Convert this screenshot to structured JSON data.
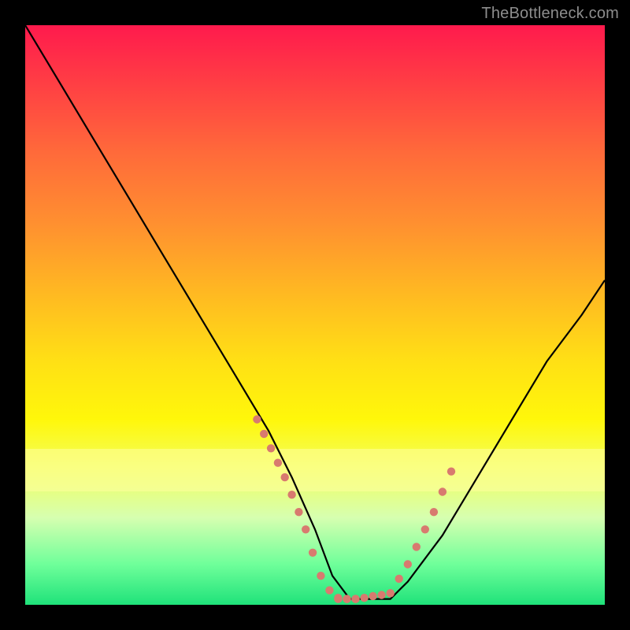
{
  "watermark": "TheBottleneck.com",
  "chart_data": {
    "type": "line",
    "title": "",
    "xlabel": "",
    "ylabel": "",
    "xlim": [
      0,
      100
    ],
    "ylim": [
      0,
      100
    ],
    "series": [
      {
        "name": "bottleneck-curve",
        "x": [
          0,
          6,
          12,
          18,
          24,
          30,
          36,
          42,
          46,
          50,
          53,
          56,
          60,
          63,
          66,
          72,
          78,
          84,
          90,
          96,
          100
        ],
        "values": [
          100,
          90,
          80,
          70,
          60,
          50,
          40,
          30,
          22,
          13,
          5,
          1,
          1,
          1,
          4,
          12,
          22,
          32,
          42,
          50,
          56
        ]
      }
    ],
    "markers": {
      "name": "dotted-highlight",
      "color": "#d87a6f",
      "left_segment": {
        "x": [
          40,
          41.2,
          42.4,
          43.6,
          44.8,
          46,
          47.2,
          48.4,
          49.6,
          51,
          52.5,
          54,
          55.5,
          57
        ],
        "y": [
          32,
          29.5,
          27,
          24.5,
          22,
          19,
          16,
          13,
          9,
          5,
          2.5,
          1.2,
          1,
          1
        ]
      },
      "right_segment": {
        "x": [
          63,
          64.5,
          66,
          67.5,
          69,
          70.5,
          72,
          73.5
        ],
        "y": [
          2,
          4.5,
          7,
          10,
          13,
          16,
          19.5,
          23
        ]
      },
      "bottom_segment": {
        "x": [
          54,
          55.5,
          57,
          58.5,
          60,
          61.5,
          63
        ],
        "y": [
          1,
          1,
          1,
          1.2,
          1.5,
          1.7,
          2
        ]
      }
    },
    "bands": [
      {
        "name": "pale-yellow-band",
        "y_from": 20,
        "y_to": 27,
        "color": "#ffffa0",
        "opacity": 0.55
      }
    ]
  }
}
